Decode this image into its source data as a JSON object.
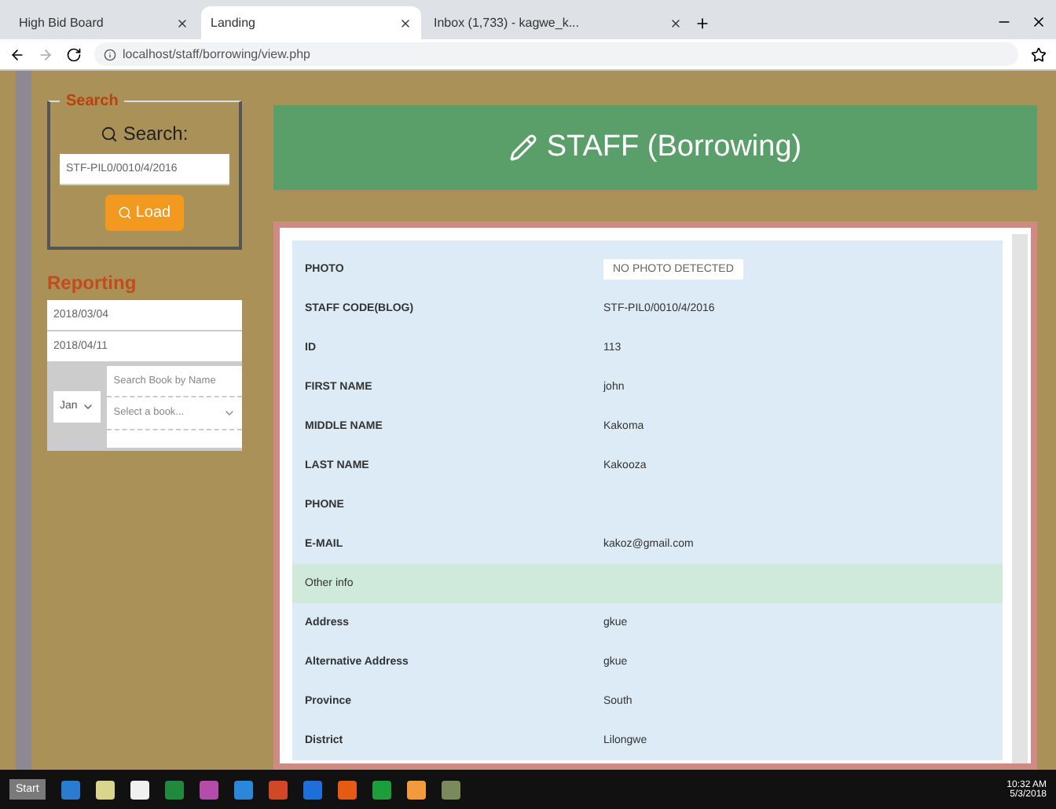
{
  "browser": {
    "tabs": [
      {
        "title": "High Bid Board",
        "selected": false
      },
      {
        "title": "Landing",
        "selected": true
      },
      {
        "title": "Inbox (1,733) - kagwe_k...",
        "selected": false
      }
    ],
    "address": "localhost/staff/borrowing/view.php"
  },
  "sidebar": {
    "search": {
      "legend": "Search",
      "label": "Search:",
      "value": "STF-PIL0/0010/4/2016",
      "button": "Load"
    },
    "reporting": {
      "title": "Reporting",
      "fields": [
        "2018/03/04",
        "2018/04/11"
      ],
      "month": "Jan",
      "book_search": {
        "placeholder": "Search Book by Name"
      },
      "book_select": "Select a book..."
    }
  },
  "header": {
    "title": "STAFF (Borrowing)"
  },
  "details": {
    "rows": [
      {
        "kind": "photo",
        "label": "PHOTO",
        "value": "NO PHOTO DETECTED"
      },
      {
        "kind": "field",
        "label": "STAFF CODE(BLOG)",
        "value": "STF-PIL0/0010/4/2016"
      },
      {
        "kind": "field",
        "label": "ID",
        "value": "113"
      },
      {
        "kind": "field",
        "label": "FIRST NAME",
        "value": "john"
      },
      {
        "kind": "field",
        "label": "MIDDLE NAME",
        "value": "Kakoma"
      },
      {
        "kind": "field",
        "label": "LAST NAME",
        "value": "Kakooza"
      },
      {
        "kind": "field",
        "label": "PHONE",
        "value": ""
      },
      {
        "kind": "field",
        "label": "E-MAIL",
        "value": "kakoz@gmail.com"
      },
      {
        "kind": "section",
        "label": "Other info"
      },
      {
        "kind": "field",
        "label": "Address",
        "value": "gkue"
      },
      {
        "kind": "field",
        "label": "Alternative Address",
        "value": "gkue"
      },
      {
        "kind": "field",
        "label": "Province",
        "value": "South"
      },
      {
        "kind": "field",
        "label": "District",
        "value": "Lilongwe"
      }
    ]
  },
  "taskbar": {
    "start": "Start",
    "clock": "10:32 AM",
    "date": "5/3/2018"
  }
}
